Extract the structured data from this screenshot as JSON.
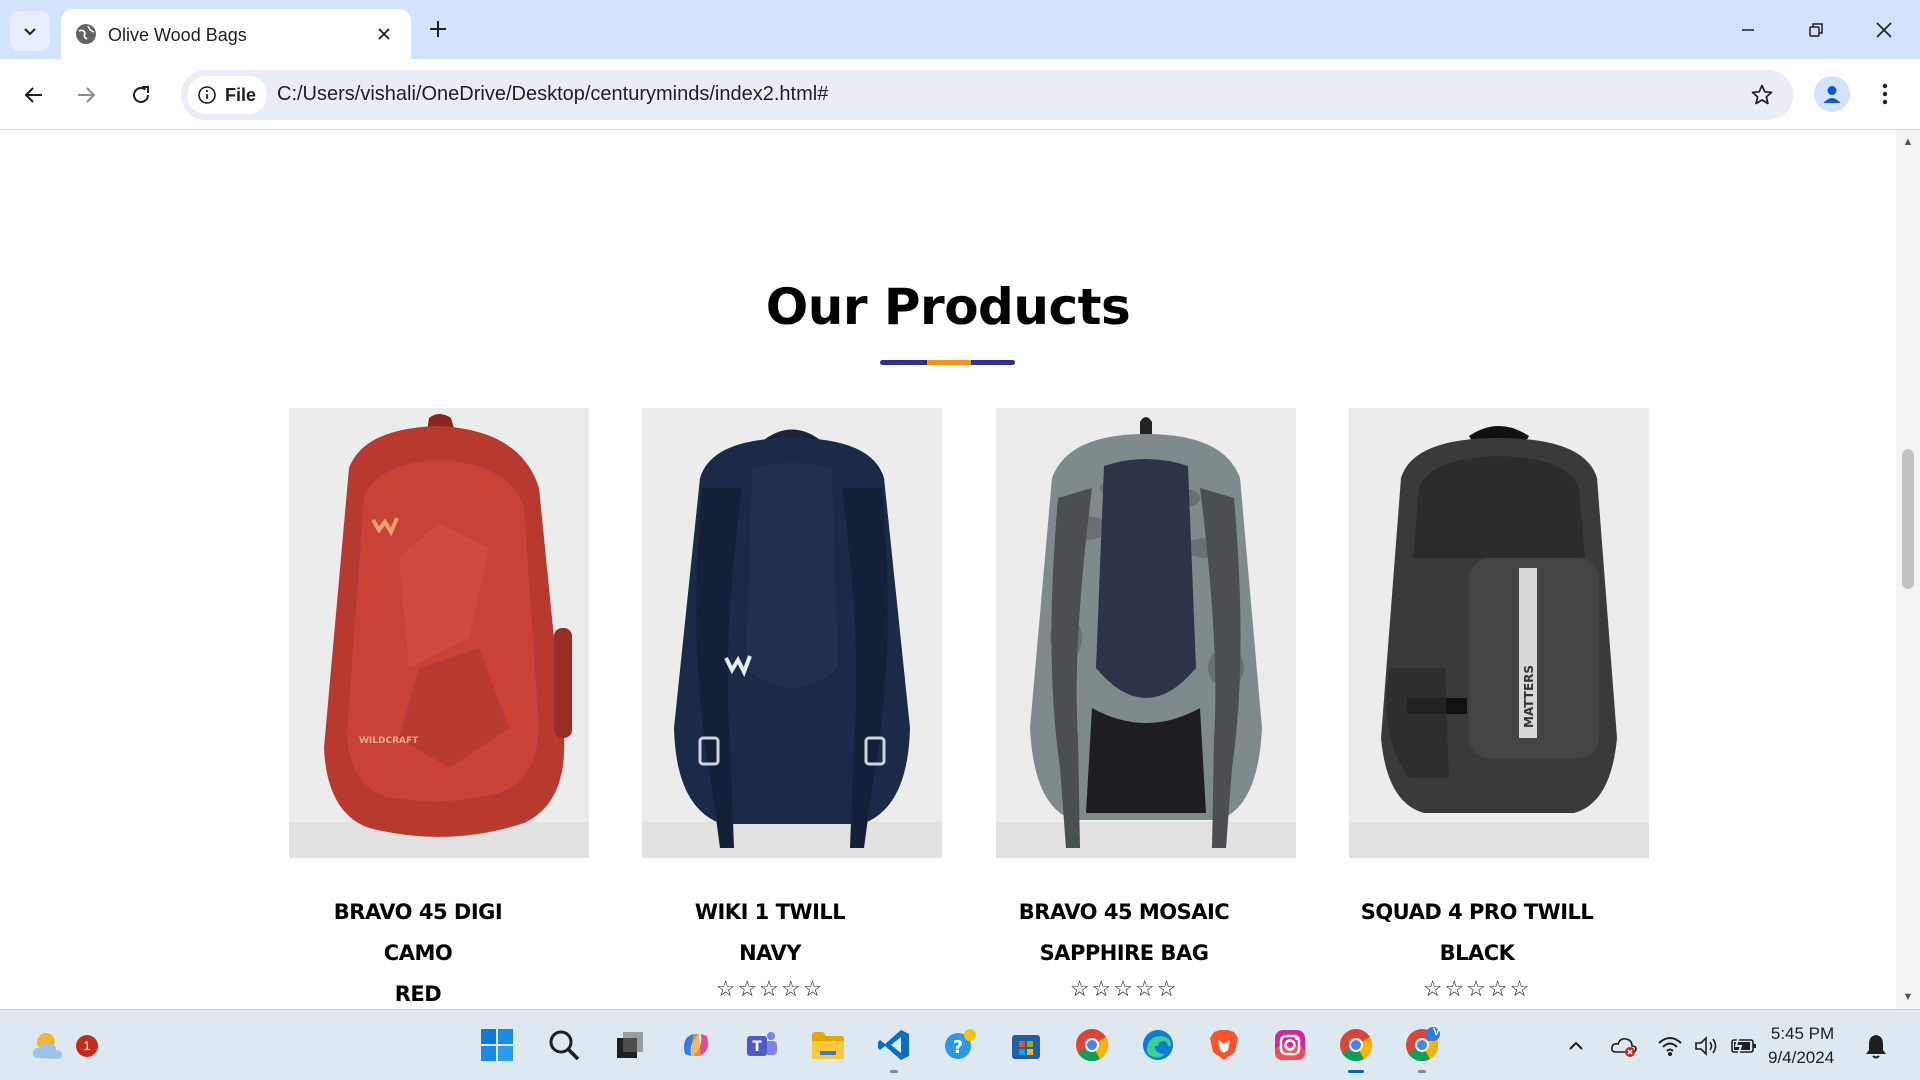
{
  "browser": {
    "tab_title": "Olive Wood Bags",
    "site_chip_label": "File",
    "url": "C:/Users/vishali/OneDrive/Desktop/centuryminds/index2.html#"
  },
  "page": {
    "section_heading": "Our Products",
    "underline_colors": [
      "#2e3192",
      "#f7941d",
      "#2e3192"
    ],
    "products": [
      {
        "name_lines": [
          "BRAVO 45 DIGI",
          "CAMO",
          "RED"
        ],
        "color": "#b8392f",
        "stars": "☆☆☆☆☆"
      },
      {
        "name_lines": [
          "WIKI 1 TWILL",
          "NAVY"
        ],
        "color": "#1b2a47",
        "stars": "☆☆☆☆☆"
      },
      {
        "name_lines": [
          "BRAVO 45 MOSAIC",
          "SAPPHIRE BAG"
        ],
        "color": "#7f8a8c",
        "stars": "☆☆☆☆☆"
      },
      {
        "name_lines": [
          "SQUAD 4 PRO TWILL",
          "BLACK"
        ],
        "color": "#3a3a3c",
        "stars": "☆☆☆☆☆"
      }
    ]
  },
  "taskbar": {
    "weather_badge": "1",
    "time": "5:45 PM",
    "date": "9/4/2024",
    "apps": [
      "windows-start",
      "search",
      "task-view",
      "copilot",
      "teams",
      "file-explorer",
      "vscode",
      "help",
      "microsoft-store",
      "chrome",
      "edge",
      "brave",
      "instagram",
      "chrome-active",
      "chrome-profile"
    ],
    "profile_badge": "V"
  }
}
